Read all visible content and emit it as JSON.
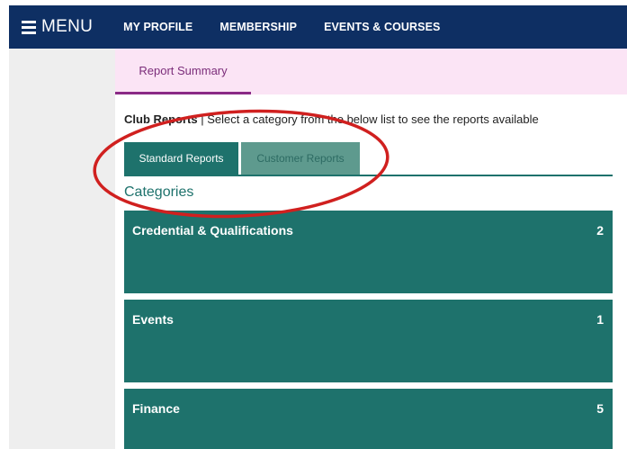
{
  "topbar": {
    "menu_label": "MENU",
    "nav": [
      "MY PROFILE",
      "MEMBERSHIP",
      "EVENTS & COURSES"
    ]
  },
  "subnav": {
    "tab_label": "Report Summary"
  },
  "intro": {
    "bold": "Club Reports",
    "text": " | Select a category from the below list to see the reports available"
  },
  "tabs": {
    "standard": "Standard Reports",
    "customer": "Customer Reports"
  },
  "categories_heading": "Categories",
  "categories": [
    {
      "name": "Credential & Qualifications",
      "count": "2"
    },
    {
      "name": "Events",
      "count": "1"
    },
    {
      "name": "Finance",
      "count": "5"
    }
  ],
  "colors": {
    "navbar": "#0e2f63",
    "teal": "#1e726c",
    "subnav_bg": "#fbe4f5",
    "subnav_accent": "#8a2a86",
    "annotation": "#d0201f"
  },
  "icons": {
    "menu": "hamburger-icon"
  }
}
